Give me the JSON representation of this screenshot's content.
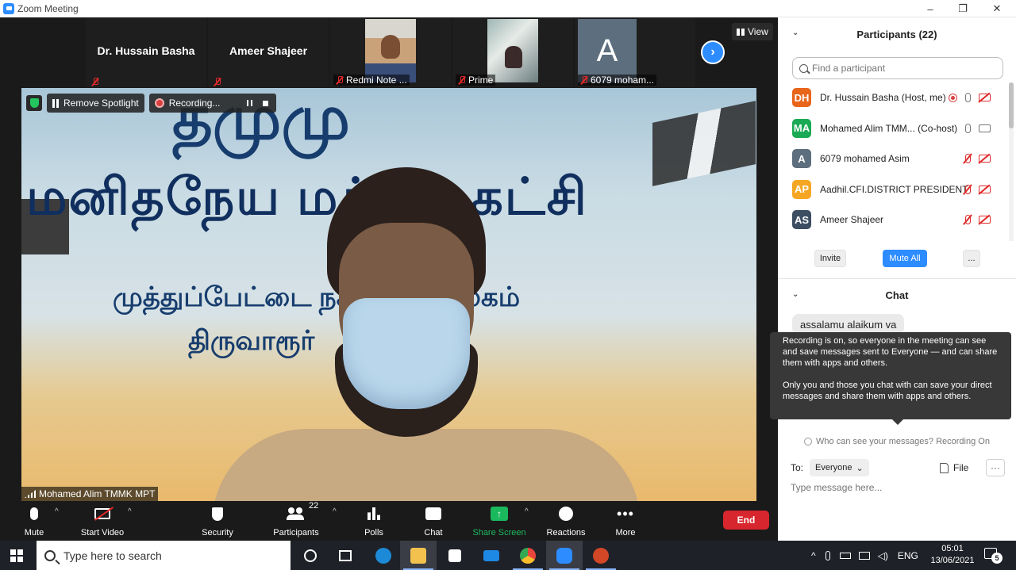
{
  "window": {
    "title": "Zoom Meeting",
    "minimize": "–",
    "maximize": "❐",
    "close": "✕"
  },
  "gallery": {
    "tiles": [
      {
        "name": "Dr. Hussain Basha",
        "label": ""
      },
      {
        "name": "Ameer Shajeer",
        "label": ""
      },
      {
        "name": "",
        "label": "Redmi Note ..."
      },
      {
        "name": "",
        "label": "Prime"
      },
      {
        "name": "",
        "label": "6079 moham...",
        "avatar_letter": "A"
      }
    ],
    "next_arrow": "›",
    "view_label": "View"
  },
  "spotlight": {
    "remove_label": "Remove Spotlight",
    "recording_label": "Recording...",
    "speaker_name": "Mohamed Alim TMMK MPT",
    "banner_top": "தமுமு",
    "banner_line": "மனிதநேய மக்கள் கட்சி",
    "banner_small": "முத்துப்பேட்டை நகர அலுவலகம்",
    "banner_small2": "திருவாரூர்"
  },
  "toolbar": {
    "mute": "Mute",
    "start_video": "Start Video",
    "security": "Security",
    "participants": "Participants",
    "participants_count": "22",
    "polls": "Polls",
    "chat": "Chat",
    "share_screen": "Share Screen",
    "share_arrow": "↑",
    "reactions": "Reactions",
    "more": "More",
    "more_dots": "•••",
    "end": "End",
    "caret": "^"
  },
  "participants": {
    "header": "Participants (22)",
    "collapse": "⌄",
    "search_placeholder": "Find a participant",
    "list": [
      {
        "initials": "DH",
        "color": "#e8651a",
        "name": "Dr. Hussain Basha (Host, me)"
      },
      {
        "initials": "MA",
        "color": "#1aaa55",
        "name": "Mohamed Alim TMM... (Co-host)"
      },
      {
        "initials": "A",
        "color": "#5d6e7e",
        "name": "6079 mohamed Asim"
      },
      {
        "initials": "AP",
        "color": "#f5a623",
        "name": "Aadhil.CFI.DISTRICT PRESIDENT"
      },
      {
        "initials": "AS",
        "color": "#3d4e63",
        "name": "Ameer Shajeer"
      }
    ],
    "invite": "Invite",
    "mute_all": "Mute All",
    "more": "..."
  },
  "chat": {
    "header": "Chat",
    "collapse": "⌄",
    "message_preview": "assalamu alaikum va",
    "tooltip_line1": "Recording is on, so everyone in the meeting can see and save messages sent to Everyone — and can share them with apps and others.",
    "tooltip_line2": "Only you and those you chat with can save your direct messages and share them with apps and others.",
    "who_can_see": "Who can see your messages? Recording On",
    "to_label": "To:",
    "to_value": "Everyone",
    "to_chevron": "⌄",
    "file_label": "File",
    "more_dots": "···",
    "input_placeholder": "Type message here..."
  },
  "taskbar": {
    "search_placeholder": "Type here to search",
    "lang": "ENG",
    "time": "05:01",
    "date": "13/06/2021",
    "notifications": "5",
    "apps": [
      {
        "name": "task-view",
        "color": "#ffffff"
      },
      {
        "name": "edge",
        "color": "#1c8ad6"
      },
      {
        "name": "file-explorer",
        "color": "#f2c14e"
      },
      {
        "name": "store",
        "color": "#ffffff"
      },
      {
        "name": "mail",
        "color": "#1e88e5"
      },
      {
        "name": "chrome",
        "color": "#e8453c"
      },
      {
        "name": "zoom",
        "color": "#2d8cff"
      },
      {
        "name": "powerpoint",
        "color": "#d24726"
      }
    ]
  }
}
